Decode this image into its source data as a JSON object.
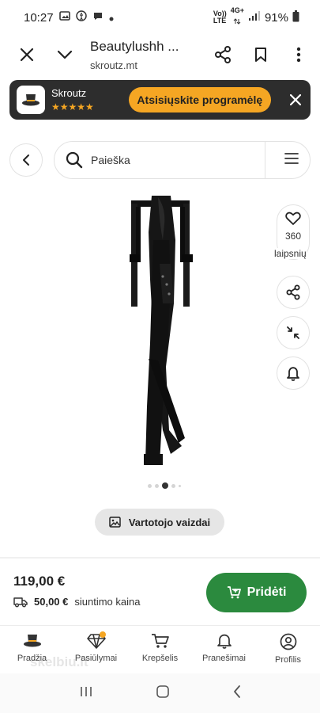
{
  "status": {
    "time": "10:27",
    "network_top": "Vo))",
    "network_bottom": "LTE",
    "signal_top": "4G+",
    "battery": "91%"
  },
  "browser": {
    "title": "Beautylushh ...",
    "domain": "skroutz.mt"
  },
  "app_banner": {
    "name": "Skroutz",
    "rating_stars": "★★★★★",
    "rating": 4.5,
    "install_label": "Atsisiųskite programėlę"
  },
  "search": {
    "placeholder": "Paieška"
  },
  "product": {
    "likes": "360",
    "likes_unit": "laipsnių",
    "gallery": {
      "count": 5,
      "active_index": 2
    },
    "user_photos_label": "Vartotojo vaizdai",
    "price": "119,00 €",
    "shipping_price": "50,00 €",
    "shipping_label": "siuntimo kaina",
    "add_label": "Pridėti"
  },
  "bottom_nav": [
    {
      "label": "Pradžia",
      "icon": "hat-icon"
    },
    {
      "label": "Pasiūlymai",
      "icon": "diamond-icon",
      "badge": true
    },
    {
      "label": "Krepšelis",
      "icon": "cart-icon"
    },
    {
      "label": "Pranešimai",
      "icon": "bell-icon"
    },
    {
      "label": "Profilis",
      "icon": "user-icon"
    }
  ],
  "watermark": "skelbiu.lt",
  "colors": {
    "accent_orange": "#f5a623",
    "banner_dark": "#2d2d2d",
    "add_green": "#2b8a3e"
  }
}
